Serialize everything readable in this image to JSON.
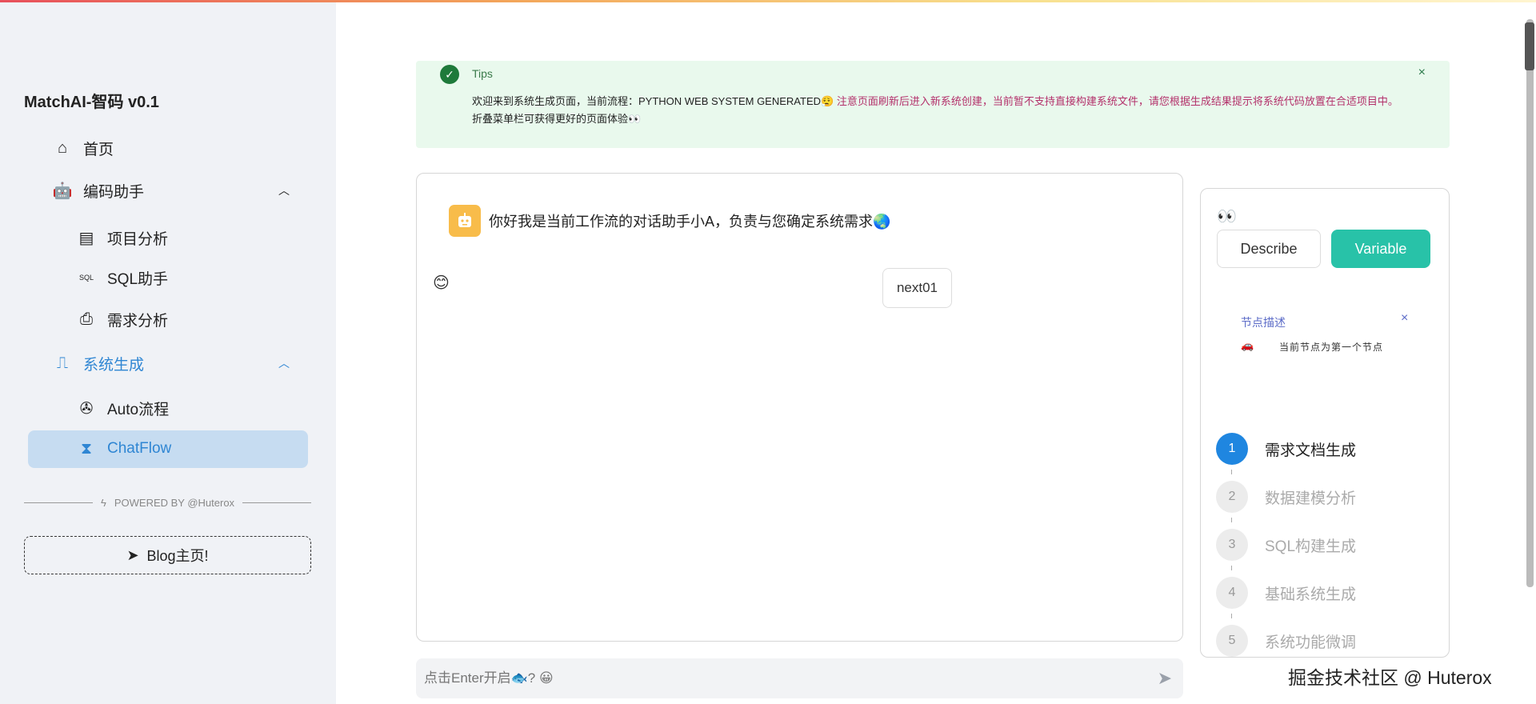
{
  "sidebar": {
    "brand": "MatchAI-智码 v0.1",
    "items": [
      {
        "label": "首页",
        "icon": "home-icon"
      },
      {
        "label": "编码助手",
        "icon": "robot-icon"
      },
      {
        "label": "项目分析",
        "icon": "comment-icon"
      },
      {
        "label": "SQL助手",
        "icon": "sql-file-icon"
      },
      {
        "label": "需求分析",
        "icon": "document-icon"
      },
      {
        "label": "系统生成",
        "icon": "flow-icon"
      },
      {
        "label": "Auto流程",
        "icon": "aperture-icon"
      },
      {
        "label": "ChatFlow",
        "icon": "hourglass-icon"
      }
    ],
    "powered": "POWERED BY @Huterox",
    "blog": "Blog主页!"
  },
  "tips": {
    "title": "Tips",
    "text": "欢迎来到系统生成页面，当前流程：PYTHON WEB SYSTEM GENERATED😮‍💨",
    "warning": "注意页面刷新后进入新系统创建，当前暂不支持直接构建系统文件，请您根据生成结果提示将系统代码放置在合适项目中。",
    "tail": "折叠菜单栏可获得更好的页面体验👀",
    "close": "×"
  },
  "chat": {
    "message": "你好我是当前工作流的对话助手小A，负责与您确定系统需求🌏",
    "user_emoji": "😊",
    "next_button": "next01"
  },
  "input": {
    "placeholder": "点击Enter开启🐟? 😀"
  },
  "panel": {
    "eyes": "👀",
    "describe": "Describe",
    "variable": "Variable",
    "node_title": "节点描述",
    "node_close": "×",
    "node_icon": "🚗",
    "node_text": "当前节点为第一个节点",
    "steps": [
      {
        "n": "1",
        "label": "需求文档生成"
      },
      {
        "n": "2",
        "label": "数据建模分析"
      },
      {
        "n": "3",
        "label": "SQL构建生成"
      },
      {
        "n": "4",
        "label": "基础系统生成"
      },
      {
        "n": "5",
        "label": "系统功能微调"
      }
    ],
    "active_step": 1
  },
  "watermark": "掘金技术社区 @ Huterox",
  "colors": {
    "accent": "#2f86d3",
    "variable": "#28c2a8",
    "step_active": "#1f86e0",
    "tips_bg": "#e9f9ed"
  }
}
